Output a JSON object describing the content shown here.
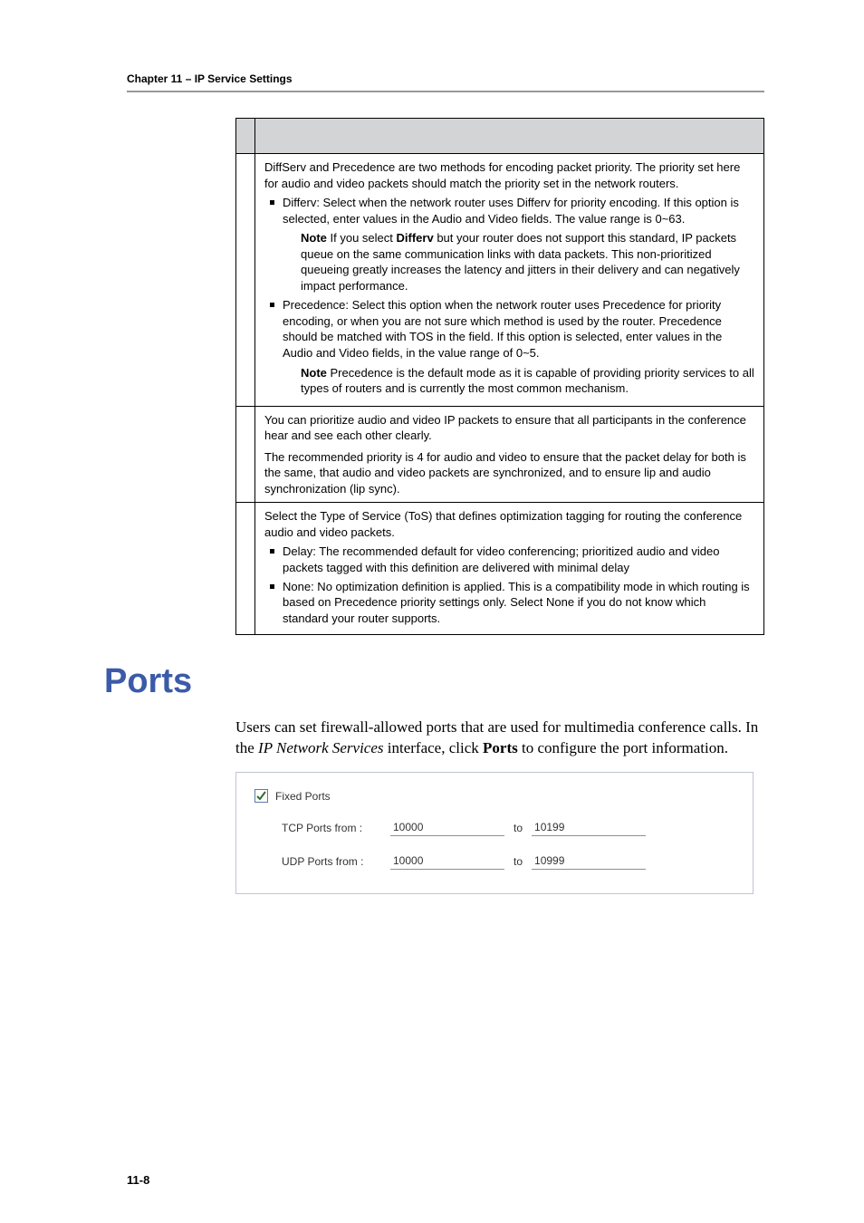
{
  "header": "Chapter 11 – IP Service Settings",
  "note_label": "Note",
  "table": {
    "rows": [
      {
        "intro": "DiffServ and Precedence are two methods for encoding packet priority. The priority set here for audio and video packets should match the priority set in the network routers.",
        "bullets": {
          "0": "Differv: Select when the network router uses Differv for priority encoding. If this option is selected, enter values in the Audio and Video fields. The value range is 0~63.",
          "1a": "Precedence: Select this option when the network router uses Precedence for priority encoding, or when you are not sure which method is used by the router. Precedence should be matched with",
          "1b": "TOS",
          "1c": "in the field. If this option is selected, enter values in the",
          "1d": "Audio",
          "1e": "and",
          "1f": "Video",
          "1g": "fields, in the value range of 0~5."
        },
        "notes": {
          "0a": "If you select",
          "0b": "Differv",
          "0c": "but your router does not support this standard, IP packets queue on the same communication links with data packets. This non-prioritized queueing greatly increases the latency and jitters in their delivery and can negatively impact performance.",
          "1": "Precedence is the default mode as it is capable of providing priority services to all types of routers and is currently the most common mechanism."
        }
      },
      {
        "p1": "You can prioritize audio and video IP packets to ensure that all participants in the conference hear and see each other clearly.",
        "p2": "The recommended priority is 4 for audio and video to ensure that the packet delay for both is the same, that audio and video packets are synchronized, and to ensure lip and audio synchronization (lip sync)."
      },
      {
        "intro": "Select the Type of Service (ToS) that defines optimization tagging for routing the conference audio and video packets.",
        "bullets": {
          "0": "Delay: The recommended default for video conferencing; prioritized audio and video packets tagged with this definition are delivered with minimal delay",
          "1a": "None: No optimization definition is applied. This is a compatibility mode in which routing is based on Precedence priority settings only. Select",
          "1b": "None",
          "1c": "if you do not know which standard your router supports."
        }
      }
    ]
  },
  "section": {
    "title": "Ports",
    "para": {
      "0": "Users can set firewall-allowed ports that are used for multimedia conference calls. In the ",
      "1": "IP Network Services",
      "2": " interface, click ",
      "3": "Ports",
      "4": " to configure the port information."
    }
  },
  "panel": {
    "checkbox_label": "Fixed Ports",
    "to_label": "to",
    "rows": [
      {
        "label": "TCP Ports from :",
        "from": "10000",
        "to": "10199"
      },
      {
        "label": "UDP Ports from :",
        "from": "10000",
        "to": "10999"
      }
    ]
  },
  "page_number": "11-8"
}
